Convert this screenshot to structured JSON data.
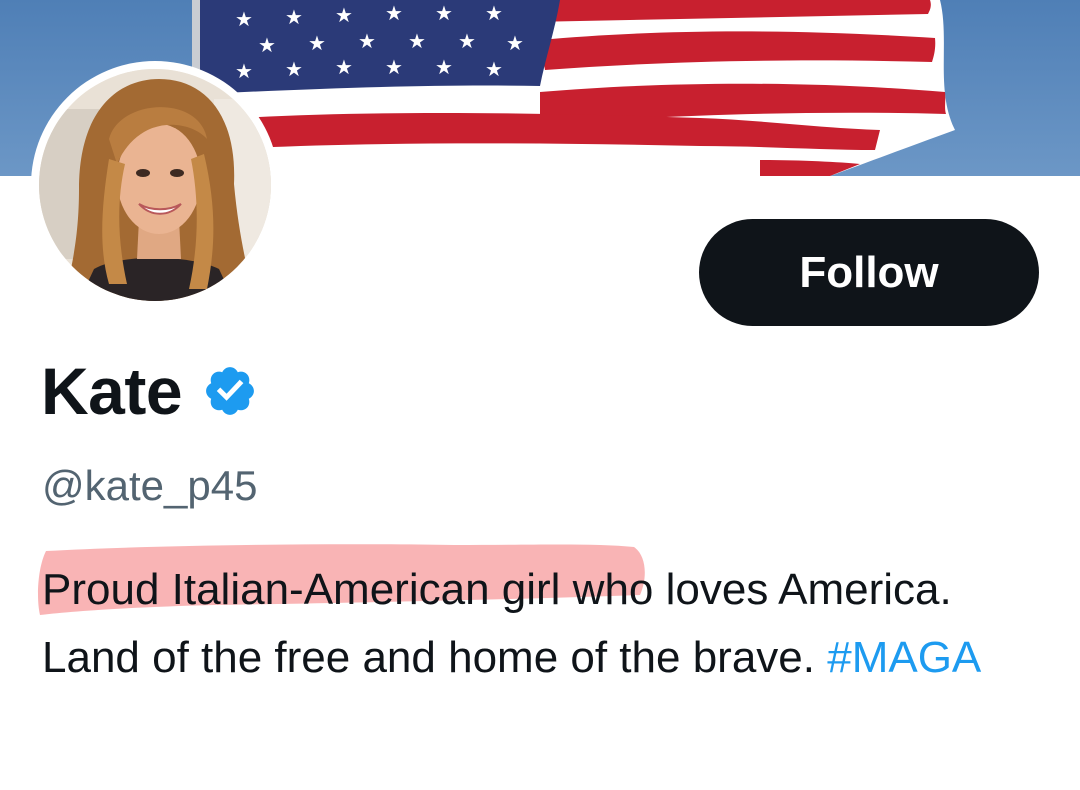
{
  "profile": {
    "display_name": "Kate",
    "handle": "@kate_p45",
    "verified": true,
    "bio_text": "Proud Italian-American girl who loves America. Land of the free and home of the brave. ",
    "bio_hashtag": "#MAGA"
  },
  "actions": {
    "follow_label": "Follow"
  },
  "colors": {
    "follow_button": "#0f1419",
    "verified_badge": "#1d9bf0",
    "hashtag": "#1d9bf0",
    "handle_text": "#536471",
    "highlight_mark": "#f7a1a3",
    "banner_sky": "#5b86b8"
  },
  "icons": {
    "verified": "verified-check-icon"
  },
  "media": {
    "banner": "american-flag-banner",
    "avatar": "profile-photo"
  }
}
